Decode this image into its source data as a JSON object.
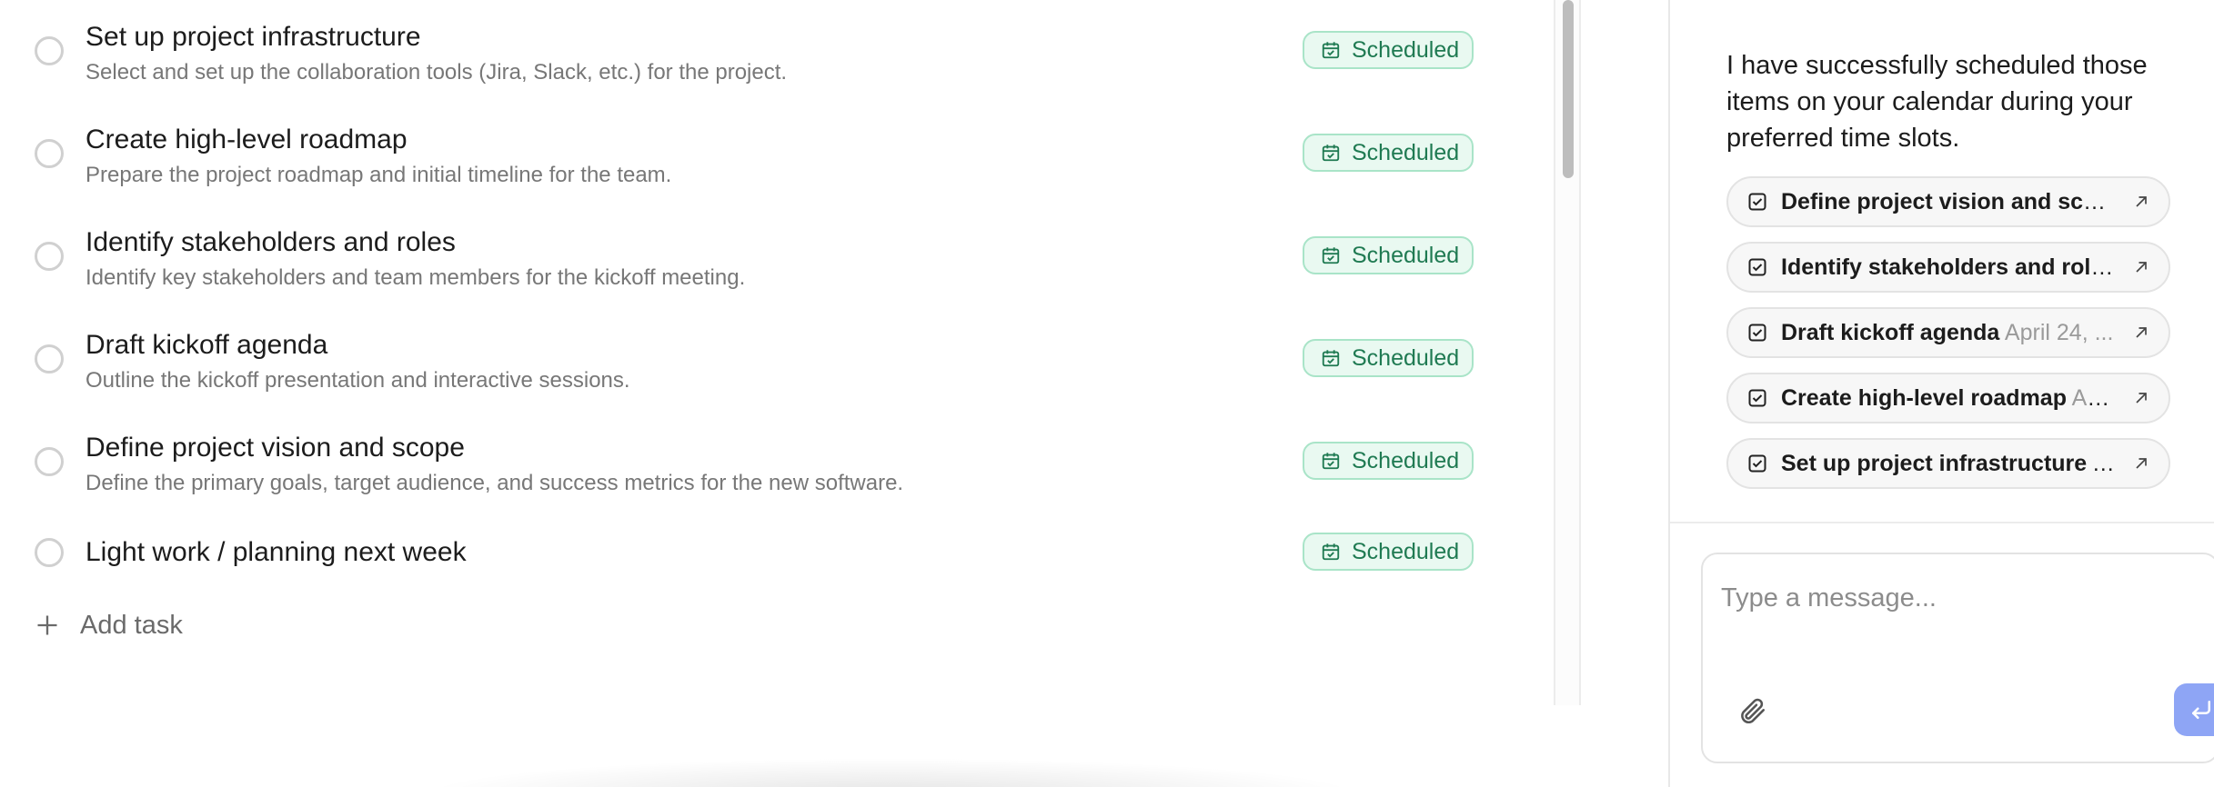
{
  "tasks": [
    {
      "title": "Set up project infrastructure",
      "description": "Select and set up the collaboration tools (Jira, Slack, etc.) for the project.",
      "status": "Scheduled"
    },
    {
      "title": "Create high-level roadmap",
      "description": "Prepare the project roadmap and initial timeline for the team.",
      "status": "Scheduled"
    },
    {
      "title": "Identify stakeholders and roles",
      "description": "Identify key stakeholders and team members for the kickoff meeting.",
      "status": "Scheduled"
    },
    {
      "title": "Draft kickoff agenda",
      "description": "Outline the kickoff presentation and interactive sessions.",
      "status": "Scheduled"
    },
    {
      "title": "Define project vision and scope",
      "description": "Define the primary goals, target audience, and success metrics for the new software.",
      "status": "Scheduled"
    },
    {
      "title": "Light work / planning next week",
      "description": "",
      "status": "Scheduled"
    }
  ],
  "add_task_label": "Add task",
  "chat": {
    "message": "I have successfully scheduled those items on your calendar during your preferred time slots.",
    "events": [
      {
        "title": "Define project vision and scop...",
        "date": ""
      },
      {
        "title": "Identify stakeholders and role...",
        "date": ""
      },
      {
        "title": "Draft kickoff agenda",
        "date": "April 24, ..."
      },
      {
        "title": "Create high-level roadmap",
        "date": "Ap..."
      },
      {
        "title": "Set up project infrastructure",
        "date": "A..."
      }
    ],
    "input_placeholder": "Type a message..."
  },
  "colors": {
    "badge_green": "#1f7a52",
    "badge_bg": "#e9f9f1",
    "send_button": "#8ea5f5"
  },
  "icons": {
    "task_status": "circle-outline-icon",
    "badge": "calendar-check-icon",
    "add_task": "plus-icon",
    "event_chip": "checkbox-icon",
    "event_open": "arrow-up-right-icon",
    "attach": "paperclip-icon",
    "send": "enter-return-icon"
  }
}
